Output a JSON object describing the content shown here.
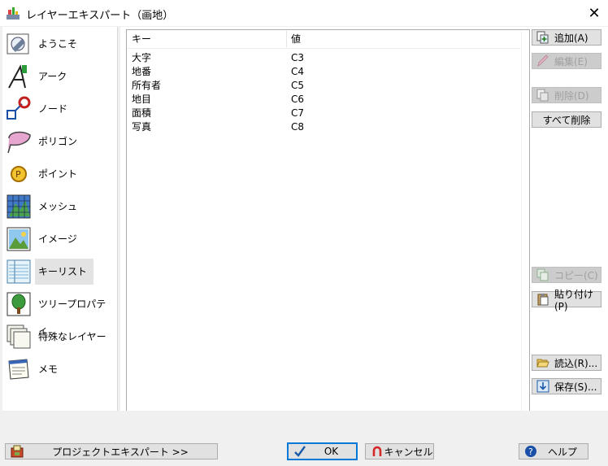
{
  "window": {
    "title": "レイヤーエキスパート（画地）",
    "close_glyph": "✕"
  },
  "sidebar": {
    "items": [
      {
        "label": "ようこそ",
        "icon": "welcome-icon"
      },
      {
        "label": "アーク",
        "icon": "arc-icon"
      },
      {
        "label": "ノード",
        "icon": "node-icon"
      },
      {
        "label": "ポリゴン",
        "icon": "polygon-icon"
      },
      {
        "label": "ポイント",
        "icon": "point-icon"
      },
      {
        "label": "メッシュ",
        "icon": "mesh-icon"
      },
      {
        "label": "イメージ",
        "icon": "image-icon"
      },
      {
        "label": "キーリスト",
        "icon": "keylist-icon",
        "selected": true
      },
      {
        "label": "ツリープロパティ",
        "icon": "tree-icon"
      },
      {
        "label": "特殊なレイヤー",
        "icon": "layers-icon"
      },
      {
        "label": "メモ",
        "icon": "memo-icon"
      }
    ]
  },
  "table": {
    "headers": {
      "key": "キー",
      "value": "値"
    },
    "rows": [
      {
        "key": "大字",
        "value": "C3"
      },
      {
        "key": "地番",
        "value": "C4"
      },
      {
        "key": "所有者",
        "value": "C5"
      },
      {
        "key": "地目",
        "value": "C6"
      },
      {
        "key": "面積",
        "value": "C7"
      },
      {
        "key": "写真",
        "value": "C8"
      }
    ]
  },
  "actions": {
    "add": "追加(A)",
    "edit": "編集(E)",
    "delete": "削除(D)",
    "delete_all": "すべて削除",
    "copy": "コピー(C)",
    "paste": "貼り付け(P)",
    "load": "読込(R)...",
    "save": "保存(S)..."
  },
  "footer": {
    "project_expert": "プロジェクトエキスパート >>",
    "ok": "OK",
    "cancel": "キャンセル",
    "help": "ヘルプ"
  },
  "colors": {
    "accent": "#0078d7",
    "disabled_text": "#a0a0a0",
    "cancel_red": "#d62828"
  }
}
